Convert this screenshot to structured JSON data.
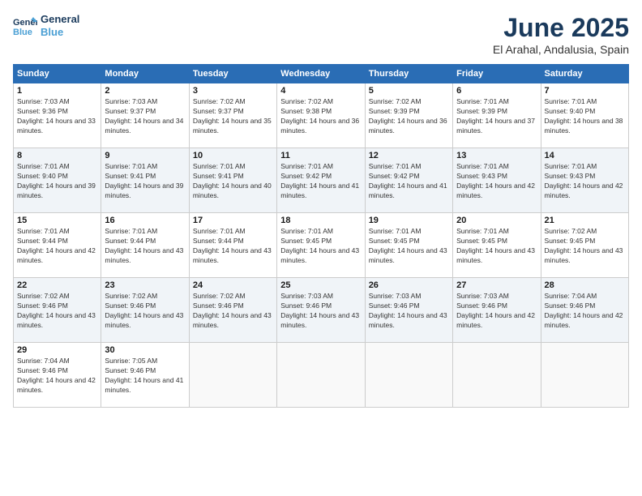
{
  "header": {
    "logo_line1": "General",
    "logo_line2": "Blue",
    "month": "June 2025",
    "location": "El Arahal, Andalusia, Spain"
  },
  "weekdays": [
    "Sunday",
    "Monday",
    "Tuesday",
    "Wednesday",
    "Thursday",
    "Friday",
    "Saturday"
  ],
  "weeks": [
    [
      {
        "day": "1",
        "sunrise": "Sunrise: 7:03 AM",
        "sunset": "Sunset: 9:36 PM",
        "daylight": "Daylight: 14 hours and 33 minutes."
      },
      {
        "day": "2",
        "sunrise": "Sunrise: 7:03 AM",
        "sunset": "Sunset: 9:37 PM",
        "daylight": "Daylight: 14 hours and 34 minutes."
      },
      {
        "day": "3",
        "sunrise": "Sunrise: 7:02 AM",
        "sunset": "Sunset: 9:37 PM",
        "daylight": "Daylight: 14 hours and 35 minutes."
      },
      {
        "day": "4",
        "sunrise": "Sunrise: 7:02 AM",
        "sunset": "Sunset: 9:38 PM",
        "daylight": "Daylight: 14 hours and 36 minutes."
      },
      {
        "day": "5",
        "sunrise": "Sunrise: 7:02 AM",
        "sunset": "Sunset: 9:39 PM",
        "daylight": "Daylight: 14 hours and 36 minutes."
      },
      {
        "day": "6",
        "sunrise": "Sunrise: 7:01 AM",
        "sunset": "Sunset: 9:39 PM",
        "daylight": "Daylight: 14 hours and 37 minutes."
      },
      {
        "day": "7",
        "sunrise": "Sunrise: 7:01 AM",
        "sunset": "Sunset: 9:40 PM",
        "daylight": "Daylight: 14 hours and 38 minutes."
      }
    ],
    [
      {
        "day": "8",
        "sunrise": "Sunrise: 7:01 AM",
        "sunset": "Sunset: 9:40 PM",
        "daylight": "Daylight: 14 hours and 39 minutes."
      },
      {
        "day": "9",
        "sunrise": "Sunrise: 7:01 AM",
        "sunset": "Sunset: 9:41 PM",
        "daylight": "Daylight: 14 hours and 39 minutes."
      },
      {
        "day": "10",
        "sunrise": "Sunrise: 7:01 AM",
        "sunset": "Sunset: 9:41 PM",
        "daylight": "Daylight: 14 hours and 40 minutes."
      },
      {
        "day": "11",
        "sunrise": "Sunrise: 7:01 AM",
        "sunset": "Sunset: 9:42 PM",
        "daylight": "Daylight: 14 hours and 41 minutes."
      },
      {
        "day": "12",
        "sunrise": "Sunrise: 7:01 AM",
        "sunset": "Sunset: 9:42 PM",
        "daylight": "Daylight: 14 hours and 41 minutes."
      },
      {
        "day": "13",
        "sunrise": "Sunrise: 7:01 AM",
        "sunset": "Sunset: 9:43 PM",
        "daylight": "Daylight: 14 hours and 42 minutes."
      },
      {
        "day": "14",
        "sunrise": "Sunrise: 7:01 AM",
        "sunset": "Sunset: 9:43 PM",
        "daylight": "Daylight: 14 hours and 42 minutes."
      }
    ],
    [
      {
        "day": "15",
        "sunrise": "Sunrise: 7:01 AM",
        "sunset": "Sunset: 9:44 PM",
        "daylight": "Daylight: 14 hours and 42 minutes."
      },
      {
        "day": "16",
        "sunrise": "Sunrise: 7:01 AM",
        "sunset": "Sunset: 9:44 PM",
        "daylight": "Daylight: 14 hours and 43 minutes."
      },
      {
        "day": "17",
        "sunrise": "Sunrise: 7:01 AM",
        "sunset": "Sunset: 9:44 PM",
        "daylight": "Daylight: 14 hours and 43 minutes."
      },
      {
        "day": "18",
        "sunrise": "Sunrise: 7:01 AM",
        "sunset": "Sunset: 9:45 PM",
        "daylight": "Daylight: 14 hours and 43 minutes."
      },
      {
        "day": "19",
        "sunrise": "Sunrise: 7:01 AM",
        "sunset": "Sunset: 9:45 PM",
        "daylight": "Daylight: 14 hours and 43 minutes."
      },
      {
        "day": "20",
        "sunrise": "Sunrise: 7:01 AM",
        "sunset": "Sunset: 9:45 PM",
        "daylight": "Daylight: 14 hours and 43 minutes."
      },
      {
        "day": "21",
        "sunrise": "Sunrise: 7:02 AM",
        "sunset": "Sunset: 9:45 PM",
        "daylight": "Daylight: 14 hours and 43 minutes."
      }
    ],
    [
      {
        "day": "22",
        "sunrise": "Sunrise: 7:02 AM",
        "sunset": "Sunset: 9:46 PM",
        "daylight": "Daylight: 14 hours and 43 minutes."
      },
      {
        "day": "23",
        "sunrise": "Sunrise: 7:02 AM",
        "sunset": "Sunset: 9:46 PM",
        "daylight": "Daylight: 14 hours and 43 minutes."
      },
      {
        "day": "24",
        "sunrise": "Sunrise: 7:02 AM",
        "sunset": "Sunset: 9:46 PM",
        "daylight": "Daylight: 14 hours and 43 minutes."
      },
      {
        "day": "25",
        "sunrise": "Sunrise: 7:03 AM",
        "sunset": "Sunset: 9:46 PM",
        "daylight": "Daylight: 14 hours and 43 minutes."
      },
      {
        "day": "26",
        "sunrise": "Sunrise: 7:03 AM",
        "sunset": "Sunset: 9:46 PM",
        "daylight": "Daylight: 14 hours and 43 minutes."
      },
      {
        "day": "27",
        "sunrise": "Sunrise: 7:03 AM",
        "sunset": "Sunset: 9:46 PM",
        "daylight": "Daylight: 14 hours and 42 minutes."
      },
      {
        "day": "28",
        "sunrise": "Sunrise: 7:04 AM",
        "sunset": "Sunset: 9:46 PM",
        "daylight": "Daylight: 14 hours and 42 minutes."
      }
    ],
    [
      {
        "day": "29",
        "sunrise": "Sunrise: 7:04 AM",
        "sunset": "Sunset: 9:46 PM",
        "daylight": "Daylight: 14 hours and 42 minutes."
      },
      {
        "day": "30",
        "sunrise": "Sunrise: 7:05 AM",
        "sunset": "Sunset: 9:46 PM",
        "daylight": "Daylight: 14 hours and 41 minutes."
      },
      null,
      null,
      null,
      null,
      null
    ]
  ]
}
